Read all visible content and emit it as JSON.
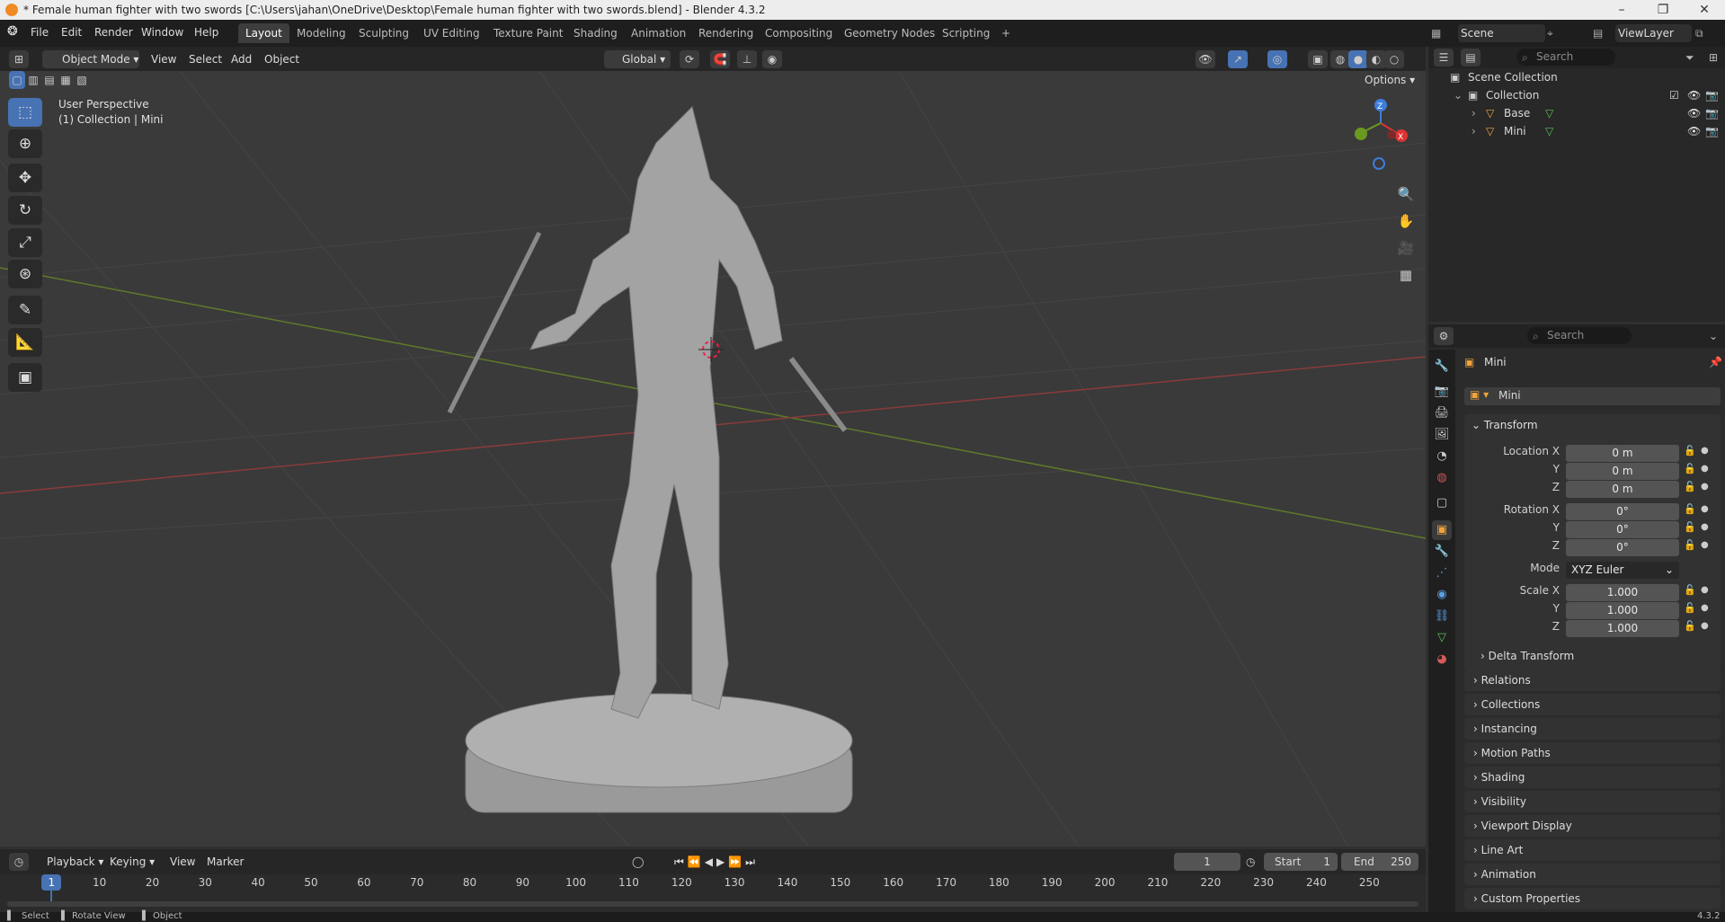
{
  "window": {
    "title": "* Female human fighter with two swords [C:\\Users\\jahan\\OneDrive\\Desktop\\Female human fighter with two swords.blend] - Blender 4.3.2"
  },
  "menu": [
    "File",
    "Edit",
    "Render",
    "Window",
    "Help"
  ],
  "workspaces": [
    "Layout",
    "Modeling",
    "Sculpting",
    "UV Editing",
    "Texture Paint",
    "Shading",
    "Animation",
    "Rendering",
    "Compositing",
    "Geometry Nodes",
    "Scripting"
  ],
  "workspace_add": "+",
  "scene": {
    "name": "Scene",
    "view_layer": "ViewLayer"
  },
  "viewport_header": {
    "mode": "Object Mode",
    "menus": [
      "View",
      "Select",
      "Add",
      "Object"
    ],
    "orientation": "Global",
    "options": "Options"
  },
  "viewport": {
    "perspective": "User Perspective",
    "collection_info": "(1) Collection | Mini",
    "gizmo": {
      "x": "X",
      "y": "Y",
      "z": "Z"
    }
  },
  "outliner": {
    "search_placeholder": "Search",
    "root": "Scene Collection",
    "collection": "Collection",
    "objects": [
      "Base",
      "Mini"
    ]
  },
  "properties": {
    "search_placeholder": "Search",
    "object_name": "Mini",
    "object_field": "Mini",
    "transform": {
      "title": "Transform",
      "location_label": "Location X",
      "rotation_label": "Rotation X",
      "scale_label": "Scale X",
      "mode_label": "Mode",
      "y": "Y",
      "z": "Z",
      "location": [
        "0 m",
        "0 m",
        "0 m"
      ],
      "rotation": [
        "0°",
        "0°",
        "0°"
      ],
      "mode": "XYZ Euler",
      "scale": [
        "1.000",
        "1.000",
        "1.000"
      ],
      "delta": "Delta Transform"
    },
    "panels": [
      "Relations",
      "Collections",
      "Instancing",
      "Motion Paths",
      "Shading",
      "Visibility",
      "Viewport Display",
      "Line Art",
      "Animation",
      "Custom Properties"
    ]
  },
  "timeline": {
    "menus": [
      "Playback",
      "Keying",
      "View",
      "Marker"
    ],
    "current_frame": "1",
    "start_label": "Start",
    "start": "1",
    "end_label": "End",
    "end": "250",
    "frames": [
      "1",
      "10",
      "20",
      "30",
      "40",
      "50",
      "60",
      "70",
      "80",
      "90",
      "100",
      "110",
      "120",
      "130",
      "140",
      "150",
      "160",
      "170",
      "180",
      "190",
      "200",
      "210",
      "220",
      "230",
      "240",
      "250"
    ]
  },
  "status": {
    "select": "Select",
    "rotate": "Rotate View",
    "object": "Object",
    "version": "4.3.2"
  },
  "colors": {
    "accent": "#4772b3",
    "selected_object": "#f0a33a"
  }
}
